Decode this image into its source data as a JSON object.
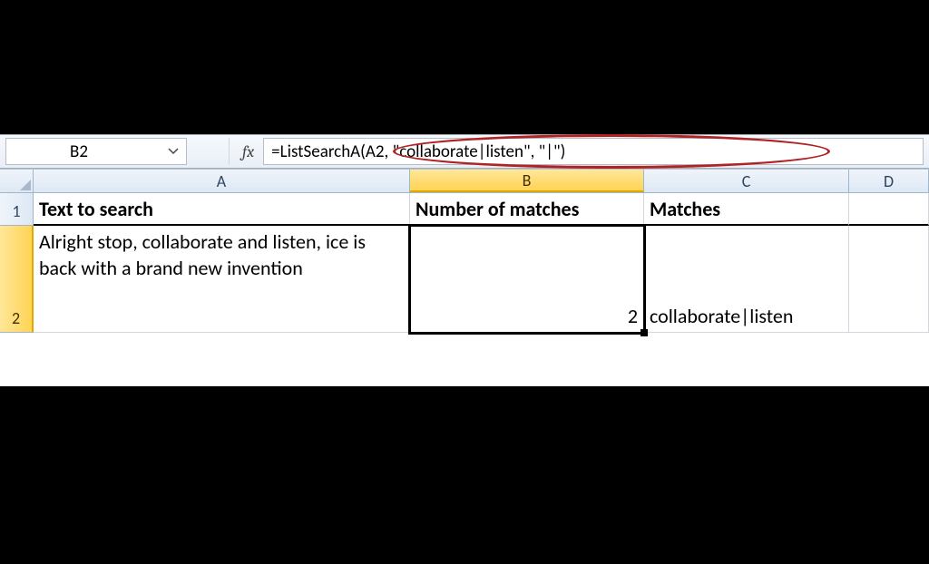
{
  "formula_bar": {
    "name_box_value": "B2",
    "fx_label": "fx",
    "formula": "=ListSearchA(A2, \"collaborate|listen\", \"|\")"
  },
  "columns": {
    "A": "A",
    "B": "B",
    "C": "C",
    "D": "D"
  },
  "rows": {
    "1": "1",
    "2": "2"
  },
  "headers": {
    "A1": "Text to search",
    "B1": "Number of matches",
    "C1": "Matches"
  },
  "cells": {
    "A2": "Alright stop, collaborate and listen, ice is back with a brand new invention",
    "B2": "2",
    "C2": "collaborate|listen"
  },
  "selected_cell": "B2"
}
